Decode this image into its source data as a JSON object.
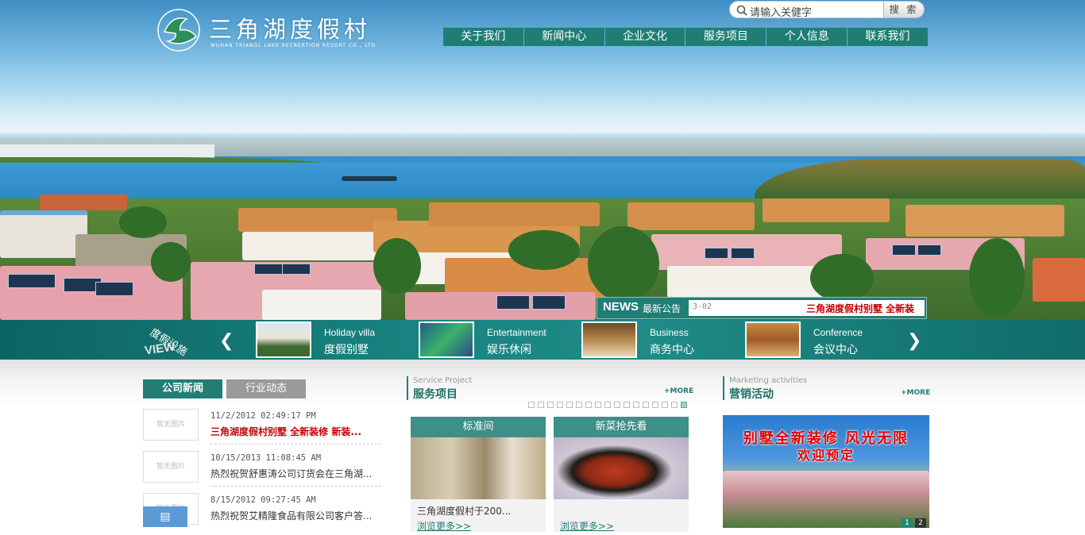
{
  "brand": {
    "name": "三角湖度假村",
    "subtitle": "WUHAN TRIANGL LAKE RECRERTION RESORT CO.，LTD"
  },
  "search": {
    "placeholder": "请输入关健字",
    "button": "搜 索"
  },
  "nav": [
    "关于我们",
    "新闻中心",
    "企业文化",
    "服务项目",
    "个人信息",
    "联系我们"
  ],
  "news_bar": {
    "label": "NEWS",
    "title": "最新公告",
    "date": "3-02",
    "headline": "三角湖度假村别墅 全新装"
  },
  "view_strip": {
    "tag_cn": "度假设施",
    "tag_en": "VIEW",
    "items": [
      {
        "en": "Holiday villa",
        "cn": "度假别墅"
      },
      {
        "en": "Entertainment",
        "cn": "娱乐休闲"
      },
      {
        "en": "Business",
        "cn": "商务中心"
      },
      {
        "en": "Conference",
        "cn": "会议中心"
      }
    ]
  },
  "news_tabs": {
    "active": "公司新闻",
    "inactive": "行业动态"
  },
  "news_list": [
    {
      "thumb": "暂无图片",
      "date": "11/2/2012 02:49:17 PM",
      "title": "三角湖度假村别墅 全新装修 新装...",
      "hot": true
    },
    {
      "thumb": "暂无图片",
      "date": "10/15/2013 11:08:45 AM",
      "title": "热烈祝贺舒惠涛公司订货会在三角湖...",
      "hot": false
    },
    {
      "thumb": "暂无图片",
      "date": "8/15/2012 09:27:45 AM",
      "title": "热烈祝贺艾精隆食品有限公司客户答...",
      "hot": false
    }
  ],
  "service": {
    "en": "Service Project",
    "cn": "服务项目",
    "more": "+MORE",
    "cards": [
      {
        "title": "标准间",
        "caption": "三角湖度假村于200...",
        "link": "浏览更多>>"
      },
      {
        "title": "新菜抢先看",
        "caption": "",
        "link": "浏览更多>>"
      }
    ]
  },
  "marketing": {
    "en": "Marketing activities",
    "cn": "营销活动",
    "more": "+MORE",
    "promo_line1": "别墅全新装修 风光无限",
    "promo_line2": "欢迎预定",
    "pages": [
      "1",
      "2"
    ]
  }
}
